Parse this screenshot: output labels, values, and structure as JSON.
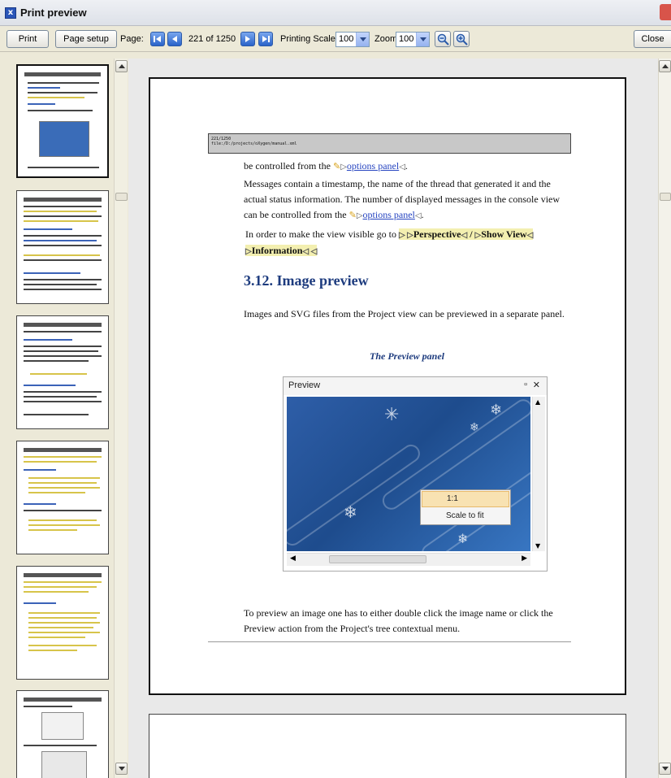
{
  "window": {
    "title": "Print preview"
  },
  "toolbar": {
    "print_label": "Print",
    "page_setup_label": "Page setup",
    "page_label": "Page:",
    "page_indicator": "221 of 1250",
    "printing_scale_label": "Printing Scale",
    "printing_scale_value": "100",
    "zoom_label": "Zoom",
    "zoom_value": "100",
    "close_label": "Close"
  },
  "page": {
    "header_line1": "221/1250",
    "header_line2": "file:/D:/projects/oXygen/manual.xml",
    "p1_text": "be controlled from the ",
    "p1_link": "options panel",
    "p2_text": "Messages contain a timestamp, the name of the thread that generated it and the actual status information. The number of displayed messages in the console view can be controlled from the ",
    "p2_link": "options panel",
    "p3_text": "In order to make the view visible go to ",
    "p3_perspective": "Perspective",
    "p3_show_view": "Show View",
    "p3_information": "Information",
    "section_title": "3.12. Image preview",
    "p4_text": "Images and SVG files from the Project view can be previewed in a separate panel.",
    "figure_caption": "The Preview panel",
    "preview_title": "Preview",
    "context_menu": [
      "1:1",
      "Scale to fit"
    ],
    "p5_text": "To preview an image one has to either double click the image name or click the Preview action from the Project's tree contextual menu."
  },
  "colors": {
    "accent": "#1d3b7e",
    "link": "#2644c0",
    "highlight": "#f3efb0"
  },
  "icons": [
    "first-page-icon",
    "previous-page-icon",
    "next-page-icon",
    "last-page-icon",
    "zoom-out-icon",
    "zoom-in-icon"
  ]
}
